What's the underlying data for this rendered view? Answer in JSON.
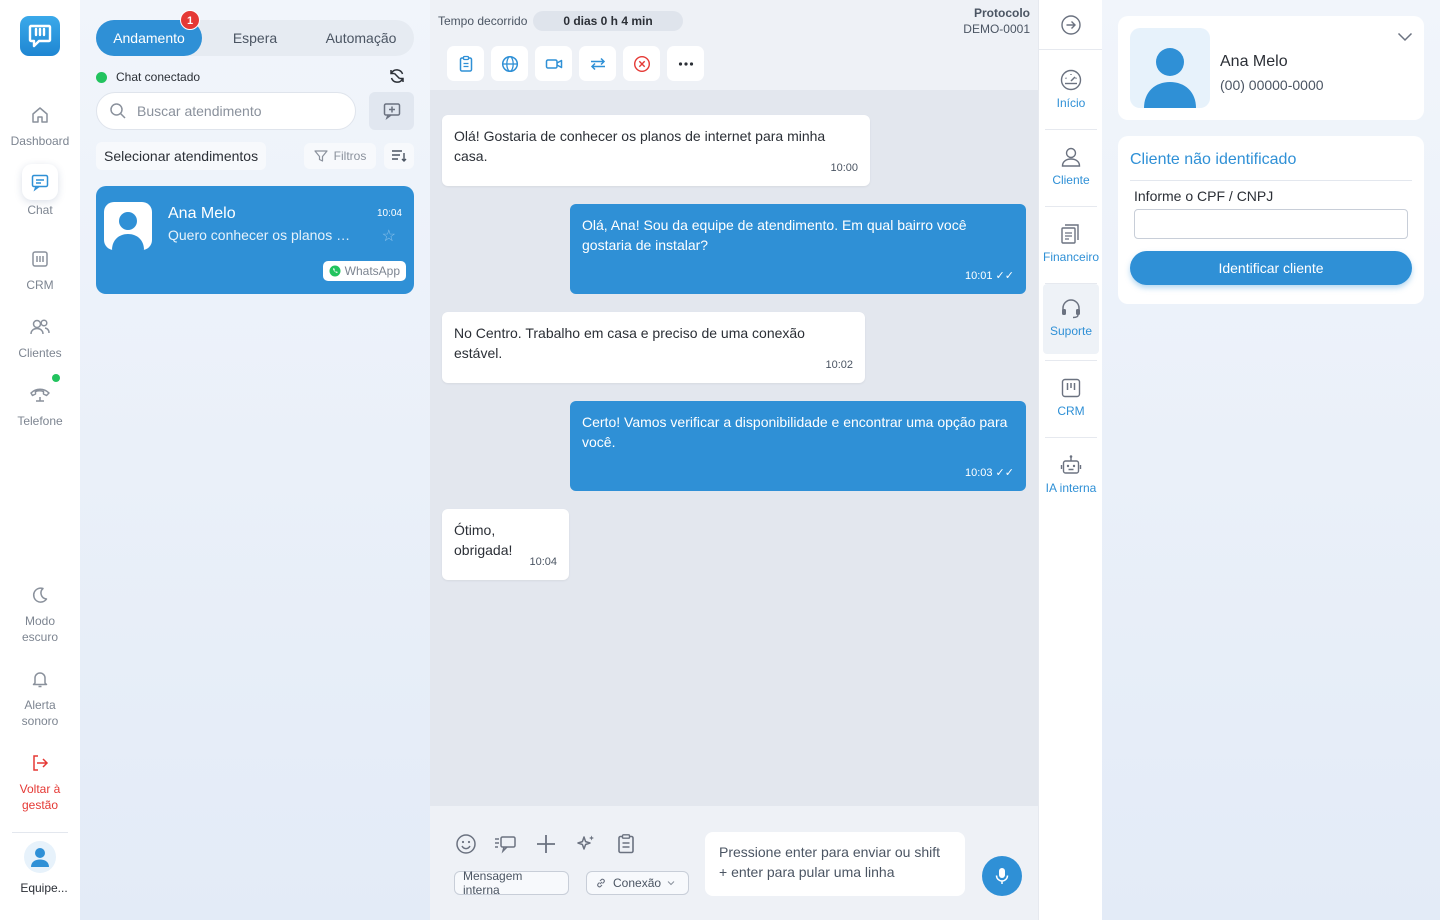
{
  "nav": {
    "items": [
      {
        "label": "Dashboard",
        "icon": "home-icon"
      },
      {
        "label": "Chat",
        "icon": "chat-icon"
      },
      {
        "label": "CRM",
        "icon": "crm-icon"
      },
      {
        "label": "Clientes",
        "icon": "users-icon"
      },
      {
        "label": "Telefone",
        "icon": "phone-icon"
      }
    ],
    "bottom": [
      {
        "label": "Modo escuro",
        "icon": "moon-icon"
      },
      {
        "label": "Alerta sonoro",
        "icon": "bell-icon"
      },
      {
        "label": "Voltar à gestão",
        "icon": "exit-icon"
      }
    ],
    "user_name": "Equipe..."
  },
  "list": {
    "tabs": [
      "Andamento",
      "Espera",
      "Automação"
    ],
    "badge": "1",
    "status": "Chat conectado",
    "search_placeholder": "Buscar atendimento",
    "select_label": "Selecionar atendimentos",
    "filter_label": "Filtros",
    "conversation": {
      "name": "Ana Melo",
      "time": "10:04",
      "preview": "Quero conhecer os planos d...",
      "channel": "WhatsApp"
    }
  },
  "chat": {
    "elapsed_label": "Tempo decorrido",
    "elapsed_value": "0 dias 0 h 4 min",
    "protocol_label": "Protocolo",
    "protocol_value": "DEMO-0001",
    "messages": [
      {
        "dir": "in",
        "text": "Olá! Gostaria de conhecer os planos de internet para minha casa.",
        "time": "10:00"
      },
      {
        "dir": "out",
        "text": "Olá, Ana! Sou da equipe de atendimento. Em qual bairro você gostaria de instalar?",
        "time": "10:01 ✓✓"
      },
      {
        "dir": "in",
        "text": "No Centro. Trabalho em casa e preciso de uma conexão estável.",
        "time": "10:02"
      },
      {
        "dir": "out",
        "text": "Certo! Vamos verificar a disponibilidade e encontrar uma opção para você.",
        "time": "10:03 ✓✓"
      },
      {
        "dir": "in",
        "text": "Ótimo, obrigada!",
        "time": "10:04"
      }
    ],
    "internal_msg_label": "Mensagem interna",
    "connection_label": "Conexão",
    "input_placeholder": "Pressione enter para enviar ou shift + enter para pular uma linha"
  },
  "rail": {
    "items": [
      "Início",
      "Cliente",
      "Financeiro",
      "Suporte",
      "CRM",
      "IA interna"
    ]
  },
  "client": {
    "name": "Ana Melo",
    "phone": "(00) 00000-0000",
    "ident_title": "Cliente não identificado",
    "cpf_label": "Informe o CPF / CNPJ",
    "cpf_value": "",
    "ident_button": "Identificar cliente"
  },
  "colors": {
    "accent": "#2f90d6",
    "online": "#22c35e",
    "danger": "#e53935"
  }
}
